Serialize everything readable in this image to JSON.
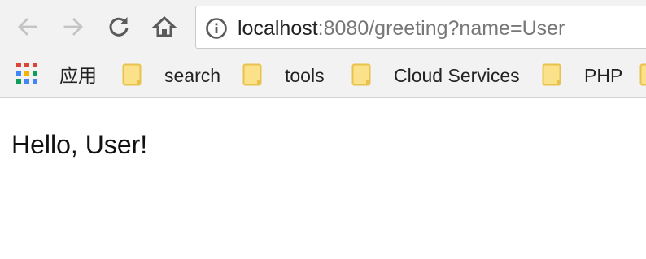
{
  "browser": {
    "nav_icons": {
      "back": "arrow-left-icon",
      "forward": "arrow-right-icon",
      "reload": "reload-icon",
      "home": "home-icon"
    },
    "address_bar": {
      "host": "localhost",
      "rest": ":8080/greeting?name=User",
      "site_info_icon": "info-circle-icon"
    },
    "bookmarks": {
      "apps_label": "应用",
      "items": [
        {
          "label": "search",
          "icon": "folder-icon"
        },
        {
          "label": "tools",
          "icon": "folder-icon"
        },
        {
          "label": "Cloud Services",
          "icon": "folder-icon"
        },
        {
          "label": "PHP",
          "icon": "folder-icon"
        }
      ]
    }
  },
  "page": {
    "greeting": "Hello, User!"
  },
  "colors": {
    "toolbar_bg": "#f2f2f2",
    "folder_fill": "#fbe28a",
    "folder_border": "#e8c24a",
    "url_host": "#222222",
    "url_rest": "#777777",
    "disabled_icon": "#c4c4c4",
    "active_icon": "#5a5a5a"
  }
}
